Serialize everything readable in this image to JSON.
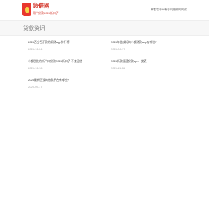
{
  "header": {
    "brand_name": "急借网",
    "tagline": "用户贷款2024新口子",
    "right_link": "来看看今天有手机借款的的款",
    "logo_colors": {
      "shield": "#e8372e",
      "emblem": "#f6d54a"
    }
  },
  "section": {
    "title": "贷款资讯"
  },
  "articles": [
    {
      "title": "2024百分百下款的网贷app排行榜",
      "date": "2024-12-04"
    },
    {
      "title": "2024年比较好的小额贷款app有哪些?",
      "date": "2024-06-17"
    },
    {
      "title": "小额秒批的新户口贷款2024新口子 不查征信",
      "date": "2025-12-16"
    },
    {
      "title": "2024新款极速贷款app一览表",
      "date": "2025-11-16"
    },
    {
      "title": "2024最新正规的借款平台有哪些?",
      "date": "2025-05-17"
    }
  ],
  "colors": {
    "brand_red": "#d43a2f",
    "section_bg": "#f7f7f7",
    "date_gray": "#aaaaaa"
  }
}
